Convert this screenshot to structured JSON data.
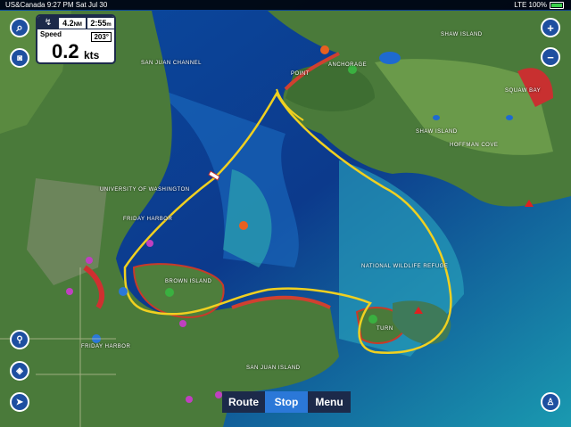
{
  "status_bar": {
    "carrier": "US&Canada",
    "time": "9:27 PM",
    "date": "Sat Jul 30",
    "network": "LTE",
    "battery": "100%"
  },
  "speed_panel": {
    "distance": "4.2",
    "distance_unit": "NM",
    "eta": "2:55",
    "eta_unit": "m",
    "label": "Speed",
    "value": "0.2",
    "unit": "kts",
    "heading": "203°"
  },
  "bottom_bar": {
    "route_label": "Route",
    "stop_label": "Stop",
    "menu_label": "Menu"
  },
  "buttons": {
    "zoom_in": "+",
    "zoom_out": "−"
  },
  "map_labels": {
    "san_juan_channel": "SAN JUAN CHANNEL",
    "shaw_island_n": "SHAW ISLAND",
    "shaw_island_mid": "SHAW ISLAND",
    "anchorage": "ANCHORAGE",
    "friday_harbor": "FRIDAY HARBOR",
    "san_juan_island": "SAN JUAN ISLAND",
    "brown_island": "BROWN ISLAND",
    "national_wildlife": "NATIONAL WILDLIFE REFUGE",
    "university": "UNIVERSITY OF WASHINGTON",
    "squaw_bay": "SQUAW BAY",
    "hoffman_cove": "HOFFMAN COVE",
    "turn_rock": "TURN",
    "point": "POINT",
    "friday_harbor_town": "FRIDAY HARBOR"
  },
  "colors": {
    "water_deep": "#0a3a8a",
    "water_shallow": "#28b4c8",
    "land": "#4a7a3a",
    "track": "#f0d020",
    "panel_dark": "#1c2a4a",
    "accent": "#2b78d8"
  }
}
